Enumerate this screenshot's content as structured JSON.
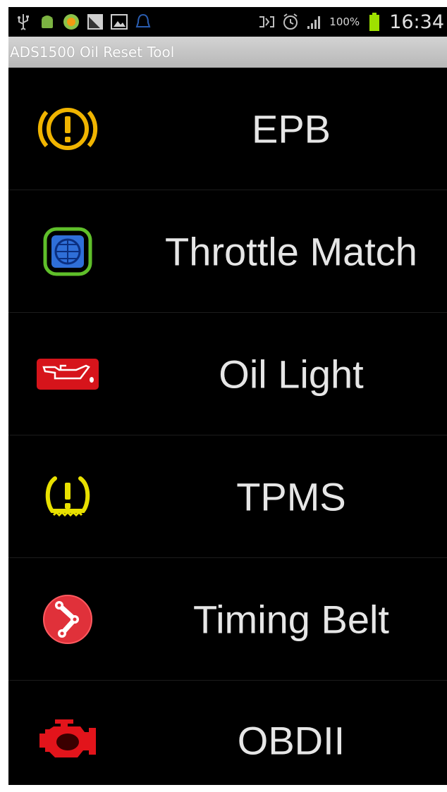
{
  "status_bar": {
    "battery_percent": "100%",
    "time": "16:34",
    "icons": [
      "usb-icon",
      "android-icon",
      "sync-icon",
      "photo-icon",
      "gallery-icon",
      "notification-icon",
      "nfc-icon",
      "alarm-icon",
      "signal-icon",
      "battery-icon"
    ]
  },
  "title_bar": {
    "title": "ADS1500 Oil Reset Tool"
  },
  "menu": {
    "items": [
      {
        "label": "EPB",
        "icon": "epb-warning-icon",
        "color": "#f0b400"
      },
      {
        "label": "Throttle Match",
        "icon": "throttle-icon",
        "color": "#2f6fd8"
      },
      {
        "label": "Oil Light",
        "icon": "oil-can-icon",
        "color": "#d6141b"
      },
      {
        "label": "TPMS",
        "icon": "tpms-icon",
        "color": "#e8e000"
      },
      {
        "label": "Timing Belt",
        "icon": "timing-belt-icon",
        "color": "#e0313a"
      },
      {
        "label": "OBDII",
        "icon": "engine-icon",
        "color": "#e2141b"
      }
    ]
  }
}
